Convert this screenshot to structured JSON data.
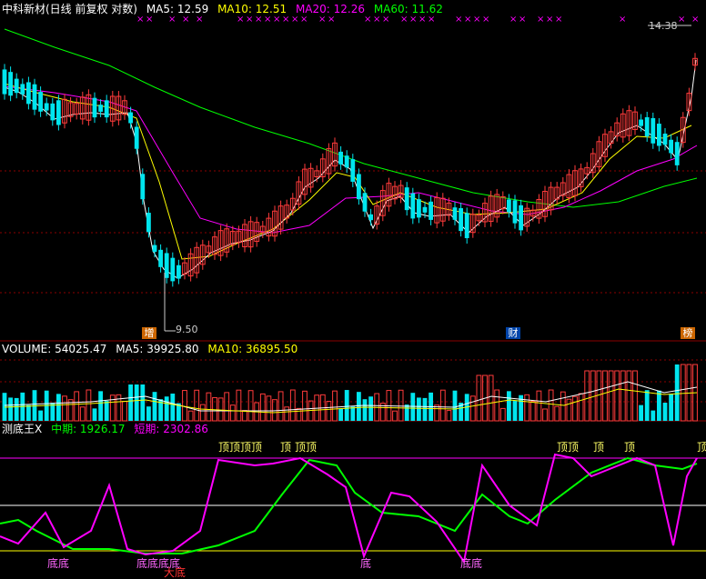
{
  "colors": {
    "up": "#ff3b3b",
    "down": "#00e5ee",
    "ma5": "#ffffff",
    "ma10": "#ffff00",
    "ma20": "#ff00ff",
    "ma60": "#00ff00",
    "grid": "#8b0000",
    "mid": "#ff00ff",
    "long": "#00ff00",
    "top_line": "#ff00ff",
    "low_line": "#ffff00",
    "white_line": "#ffffff"
  },
  "main": {
    "title": "中科新材(日线 前复权 对数)",
    "ma5_label": "MA5: 12.59",
    "ma10_label": "MA10: 12.51",
    "ma20_label": "MA20: 12.26",
    "ma60_label": "MA60: 11.62",
    "high_label": "14.38",
    "low_label": "9.50",
    "markers": [
      "增",
      "财",
      "榜"
    ]
  },
  "volume": {
    "vol_label": "VOLUME: 54025.47",
    "ma5_label": "MA5: 39925.80",
    "ma10_label": "MA10: 36895.50"
  },
  "indicator": {
    "name": "测底王X",
    "mid_label": "中期: 1926.17",
    "short_label": "短期: 2302.86",
    "top_glyph": "顶",
    "bottom_glyph": "底",
    "big_bottom": "大底"
  }
}
